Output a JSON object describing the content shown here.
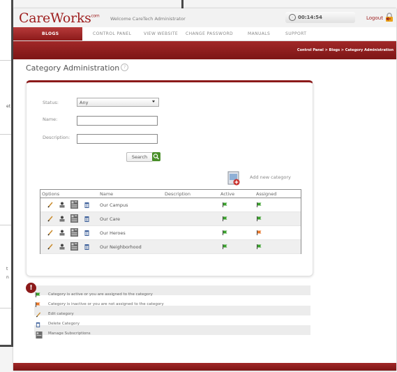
{
  "header": {
    "logo": "CareWorks",
    "logo_mark": "com",
    "welcome": "Welcome CareTech Administrator",
    "timer": "00:14:54",
    "logout": "Logout"
  },
  "nav": {
    "items": [
      {
        "label": "BLOGS",
        "active": true
      },
      {
        "label": "CONTROL PANEL"
      },
      {
        "label": "VIEW WEBSITE"
      },
      {
        "label": "CHANGE PASSWORD"
      },
      {
        "label": "MANUALS"
      },
      {
        "label": "SUPPORT"
      }
    ]
  },
  "breadcrumb": "Control Panel > Blogs > Category Administration",
  "page": {
    "title": "Category Administration",
    "help": "?"
  },
  "filters": {
    "status_label": "Status:",
    "status_value": "Any",
    "name_label": "Name:",
    "name_value": "",
    "description_label": "Description:",
    "description_value": "",
    "search_label": "Search"
  },
  "add_category_label": "Add new category",
  "table": {
    "headers": [
      "Options",
      "Name",
      "Description",
      "Active",
      "Assigned"
    ],
    "rows": [
      {
        "name": "Our Campus",
        "description": "",
        "active": "green",
        "assigned": "green"
      },
      {
        "name": "Our Care",
        "description": "",
        "active": "green",
        "assigned": "green"
      },
      {
        "name": "Our Heroes",
        "description": "",
        "active": "green",
        "assigned": "orange"
      },
      {
        "name": "Our Neighborhood",
        "description": "",
        "active": "green",
        "assigned": "green"
      }
    ]
  },
  "legend": {
    "items": [
      {
        "icon": "green-flag-icon",
        "text": "Category is active or you are assigned to the category"
      },
      {
        "icon": "orange-flag-icon",
        "text": "Category is inactive or you are not assigned to the category"
      },
      {
        "icon": "pencil-icon",
        "text": "Edit category"
      },
      {
        "icon": "trash-icon",
        "text": "Delete Category"
      },
      {
        "icon": "subscriptions-icon",
        "text": "Manage Subscriptions"
      }
    ]
  },
  "colors": {
    "brand": "#8c1a1a",
    "flag_green": "#3aa02c",
    "flag_orange": "#e8772a"
  }
}
